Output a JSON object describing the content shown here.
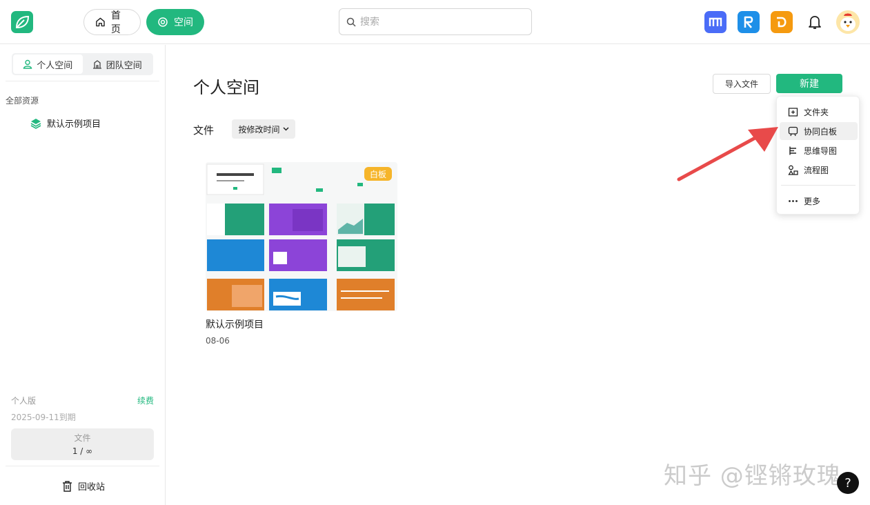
{
  "header": {
    "nav": [
      {
        "label": "首页",
        "icon": "home-icon"
      },
      {
        "label": "空间",
        "icon": "space-icon"
      }
    ],
    "search": {
      "placeholder": "搜索"
    },
    "apps": [
      {
        "icon": "app-m-icon",
        "color": "#4a6cf7"
      },
      {
        "icon": "app-r-icon",
        "color": "#1e8fe8"
      },
      {
        "icon": "app-d-icon",
        "color": "#f59a10"
      }
    ],
    "accent": "#22b87f"
  },
  "sidebar": {
    "tabs": [
      {
        "label": "个人空间",
        "icon": "user-icon"
      },
      {
        "label": "团队空间",
        "icon": "building-icon"
      }
    ],
    "section_title": "全部资源",
    "tree": [
      {
        "label": "默认示例项目",
        "icon": "layers-icon"
      }
    ],
    "plan": {
      "name": "个人版",
      "renew": "续费",
      "expiry": "2025-09-11到期"
    },
    "quota": {
      "label": "文件",
      "value": "1 / ∞"
    },
    "trash": "回收站"
  },
  "main": {
    "title": "个人空间",
    "import_label": "导入文件",
    "new_label": "新建",
    "files_label": "文件",
    "sort_label": "按修改时间",
    "cards": [
      {
        "name": "默认示例项目",
        "date": "08-06",
        "badge": "白板"
      }
    ]
  },
  "new_menu": {
    "items": [
      {
        "label": "文件夹",
        "icon": "folder-add-icon"
      },
      {
        "label": "协同白板",
        "icon": "whiteboard-icon"
      },
      {
        "label": "思维导图",
        "icon": "mindmap-icon"
      },
      {
        "label": "流程图",
        "icon": "flowchart-icon"
      },
      {
        "label": "更多",
        "icon": "more-icon"
      }
    ]
  },
  "watermark": "知乎 @铿锵玫瑰",
  "help": "?"
}
